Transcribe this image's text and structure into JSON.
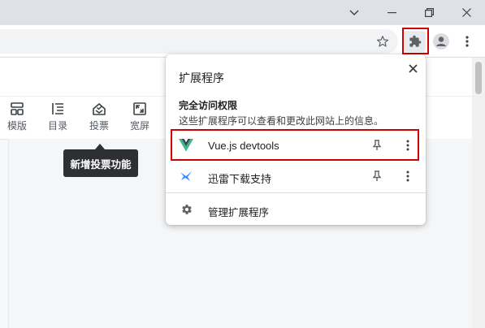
{
  "toolbar_tools": [
    {
      "label": "模版",
      "icon": "template-icon"
    },
    {
      "label": "目录",
      "icon": "toc-icon"
    },
    {
      "label": "投票",
      "icon": "vote-icon"
    },
    {
      "label": "宽屏",
      "icon": "widescreen-icon"
    }
  ],
  "tooltip": {
    "text": "新增投票功能"
  },
  "extensions_popup": {
    "title": "扩展程序",
    "full_access_heading": "完全访问权限",
    "full_access_desc": "这些扩展程序可以查看和更改此网站上的信息。",
    "items": [
      {
        "name": "Vue.js devtools",
        "icon": "vue-logo-icon",
        "pinned": false
      },
      {
        "name": "迅雷下载支持",
        "icon": "thunder-icon",
        "pinned": false
      }
    ],
    "manage_label": "管理扩展程序"
  },
  "colors": {
    "highlight": "#d00000",
    "vue_green": "#41b883",
    "vue_dark": "#35495e",
    "thunder_blue": "#3d8bff"
  }
}
